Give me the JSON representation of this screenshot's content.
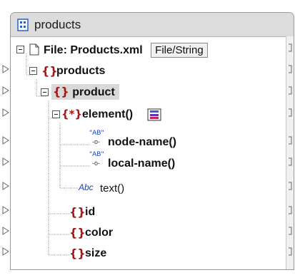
{
  "component": {
    "title": "products",
    "title_icon": "xml-schema-icon"
  },
  "tree": {
    "file_label": "File: Products.xml",
    "file_button": "File/String",
    "root": "products",
    "product": "product",
    "element_fn": "element()",
    "node_name": "node-name()",
    "local_name": "local-name()",
    "text_fn": "text()",
    "id": "id",
    "color": "color",
    "size": "size",
    "ab_badge": "AB",
    "abc_badge": "Abc"
  },
  "colors": {
    "element_brace": "#a01818",
    "ab_blue": "#1a3fbf",
    "title_bar": "#dcdcdc"
  }
}
